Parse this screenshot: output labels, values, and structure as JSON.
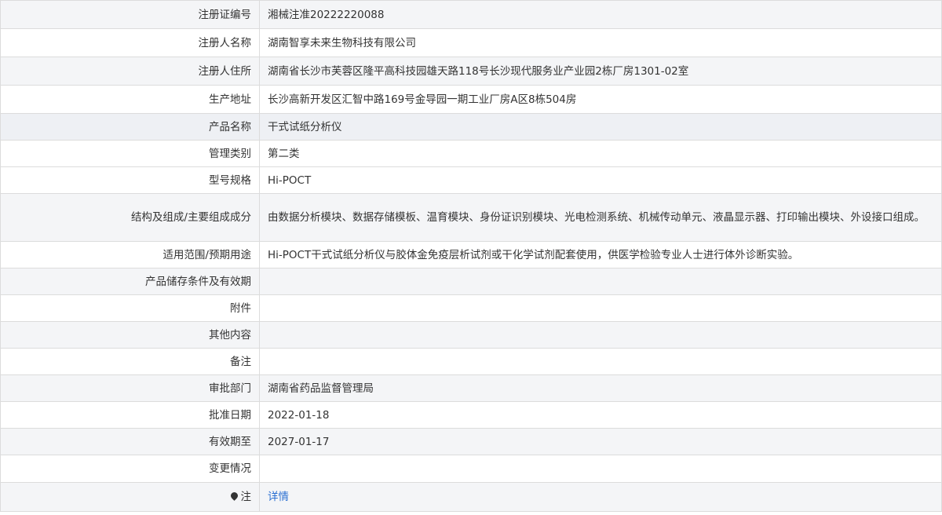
{
  "rows": [
    {
      "label": "注册证编号",
      "value": "湘械注准20222220088"
    },
    {
      "label": "注册人名称",
      "value": "湖南智享未来生物科技有限公司"
    },
    {
      "label": "注册人住所",
      "value": "湖南省长沙市芙蓉区隆平高科技园雄天路118号长沙现代服务业产业园2栋厂房1301-02室"
    },
    {
      "label": "生产地址",
      "value": "长沙高新开发区汇智中路169号金导园一期工业厂房A区8栋504房"
    },
    {
      "label": "产品名称",
      "value": "干式试纸分析仪"
    },
    {
      "label": "管理类别",
      "value": "第二类"
    },
    {
      "label": "型号规格",
      "value": "Hi-POCT"
    },
    {
      "label": "结构及组成/主要组成成分",
      "value": "由数据分析模块、数据存储模板、温育模块、身份证识别模块、光电检测系统、机械传动单元、液晶显示器、打印输出模块、外设接口组成。"
    },
    {
      "label": "适用范围/预期用途",
      "value": "Hi-POCT干式试纸分析仪与胶体金免疫层析试剂或干化学试剂配套使用，供医学检验专业人士进行体外诊断实验。"
    },
    {
      "label": "产品储存条件及有效期",
      "value": ""
    },
    {
      "label": "附件",
      "value": ""
    },
    {
      "label": "其他内容",
      "value": ""
    },
    {
      "label": "备注",
      "value": ""
    },
    {
      "label": "审批部门",
      "value": "湖南省药品监督管理局"
    },
    {
      "label": "批准日期",
      "value": "2022-01-18"
    },
    {
      "label": "有效期至",
      "value": "2027-01-17"
    },
    {
      "label": "变更情况",
      "value": ""
    }
  ],
  "note": {
    "label": "注",
    "link_text": "详情",
    "icon": "pin-icon"
  }
}
